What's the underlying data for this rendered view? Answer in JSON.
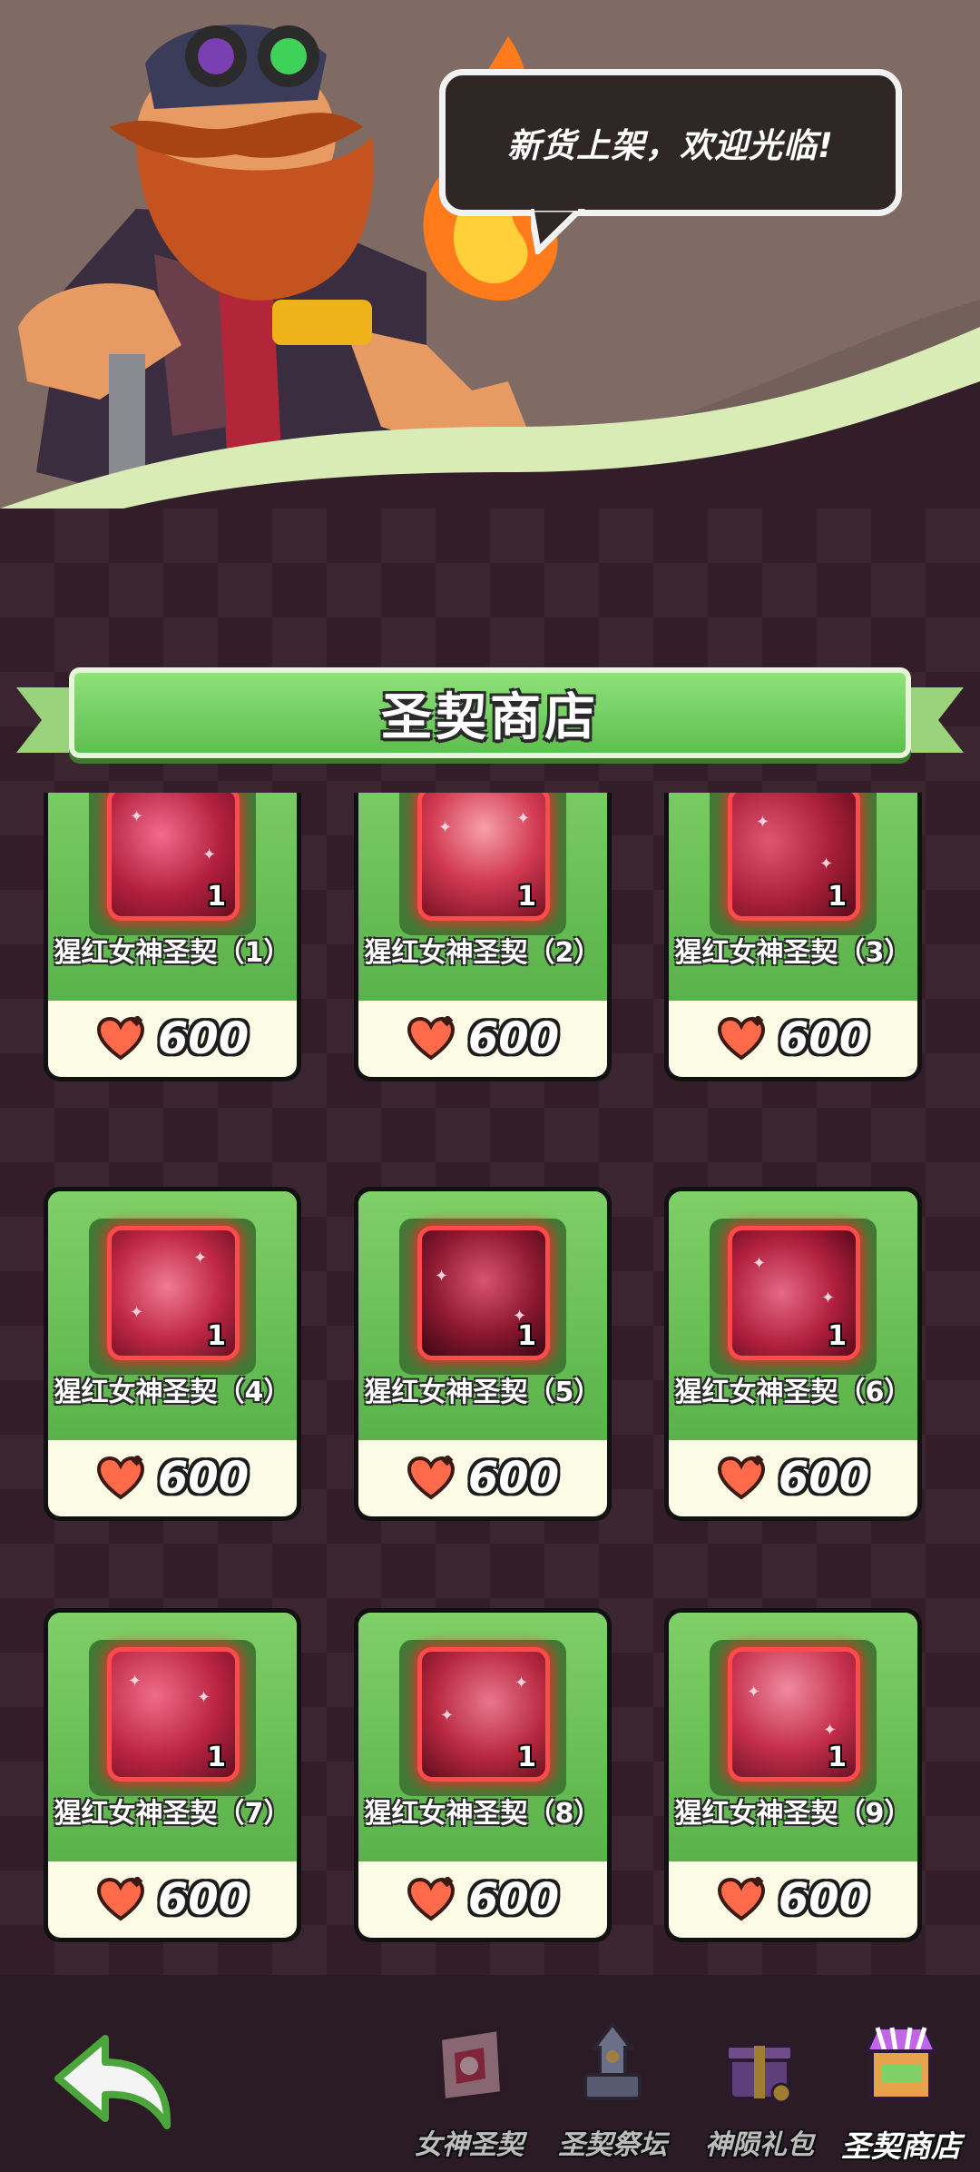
{
  "shopkeeper": {
    "speech": "新货上架，欢迎光临!"
  },
  "shop": {
    "title": "圣契商店",
    "items": [
      {
        "name": "猩红女神圣契（1）",
        "count": "1",
        "price": "600"
      },
      {
        "name": "猩红女神圣契（2）",
        "count": "1",
        "price": "600"
      },
      {
        "name": "猩红女神圣契（3）",
        "count": "1",
        "price": "600"
      },
      {
        "name": "猩红女神圣契（4）",
        "count": "1",
        "price": "600"
      },
      {
        "name": "猩红女神圣契（5）",
        "count": "1",
        "price": "600"
      },
      {
        "name": "猩红女神圣契（6）",
        "count": "1",
        "price": "600"
      },
      {
        "name": "猩红女神圣契（7）",
        "count": "1",
        "price": "600"
      },
      {
        "name": "猩红女神圣契（8）",
        "count": "1",
        "price": "600"
      },
      {
        "name": "猩红女神圣契（9）",
        "count": "1",
        "price": "600"
      }
    ]
  },
  "nav": {
    "back_icon": "back-arrow-icon",
    "tabs": [
      {
        "label": "女神圣契",
        "icon": "goddess-contract-icon",
        "active": false
      },
      {
        "label": "圣契祭坛",
        "icon": "altar-icon",
        "active": false
      },
      {
        "label": "神陨礼包",
        "icon": "gift-pack-icon",
        "active": false
      },
      {
        "label": "圣契商店",
        "icon": "shop-stall-icon",
        "active": true
      }
    ]
  },
  "colors": {
    "card_green": "#6cc257",
    "price_bg": "#fbfbe6",
    "rarity_glow": "#ff4b4b",
    "background": "#331d28"
  }
}
